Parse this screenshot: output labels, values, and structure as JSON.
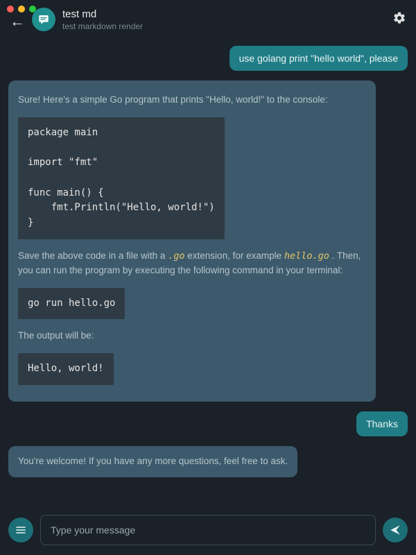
{
  "header": {
    "title": "test md",
    "subtitle": "test markdown render"
  },
  "messages": {
    "user1": "use golang print \"hello world\",    please",
    "bot1_intro": "Sure! Here's a simple Go program that prints \"Hello, world!\" to the console:",
    "bot1_code1": "package main\n\nimport \"fmt\"\n\nfunc main() {\n    fmt.Println(\"Hello, world!\")\n}",
    "bot1_savepre": "Save the above code in a file with a ",
    "bot1_ext": ".go",
    "bot1_savemid": " extension, for example ",
    "bot1_filename": "hello.go",
    "bot1_then": ". Then, you can run the program by executing the following command in your terminal:",
    "bot1_code2": "go run hello.go",
    "bot1_outlabel": "The output will be:",
    "bot1_code3": "Hello, world!",
    "user2": "Thanks",
    "bot2": "You're welcome! If you have any more questions, feel free to ask."
  },
  "input": {
    "placeholder": "Type your message"
  }
}
